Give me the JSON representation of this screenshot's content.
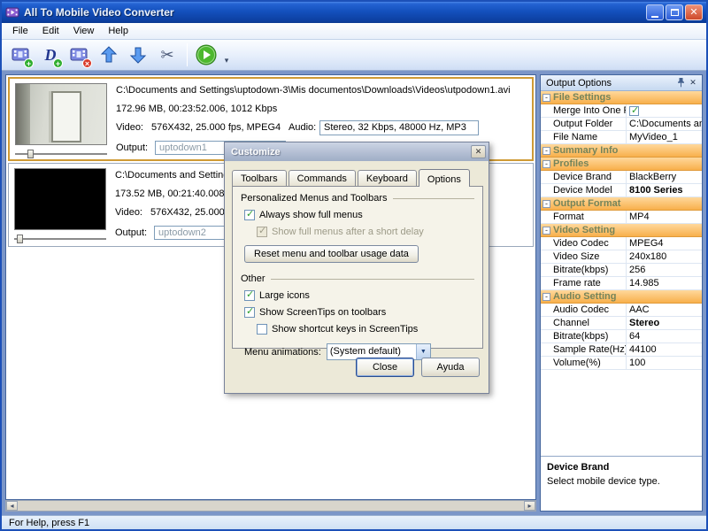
{
  "window": {
    "title": "All To Mobile Video Converter",
    "status": "For Help, press F1"
  },
  "menu": {
    "items": [
      "File",
      "Edit",
      "View",
      "Help"
    ]
  },
  "labels": {
    "video": "Video:",
    "audio": "Audio:",
    "output": "Output:"
  },
  "files": [
    {
      "path": "C:\\Documents and Settings\\uptodown-3\\Mis documentos\\Downloads\\Videos\\utpodown1.avi",
      "info": "172.96 MB, 00:23:52.006, 1012 Kbps",
      "video": "576X432, 25.000 fps, MPEG4",
      "audio": "Stereo, 32 Kbps, 48000 Hz, MP3",
      "output": "uptodown1"
    },
    {
      "path": "C:\\Documents and Settings\\u",
      "info": "173.52 MB, 00:21:40.008, 1",
      "video": "576X432, 25.000 fps,",
      "output": "uptodown2"
    }
  ],
  "dialog": {
    "title": "Customize",
    "tabs": [
      "Toolbars",
      "Commands",
      "Keyboard",
      "Options"
    ],
    "personalized_title": "Personalized Menus and Toolbars",
    "cb_full_menus": "Always show full menus",
    "cb_full_menus_delay": "Show full menus after a short delay",
    "reset_button": "Reset menu and toolbar usage data",
    "other_title": "Other",
    "cb_large_icons": "Large icons",
    "cb_screentips": "Show ScreenTips on toolbars",
    "cb_shortcut_keys": "Show shortcut keys in ScreenTips",
    "menu_animations_label": "Menu animations:",
    "menu_animations_value": "(System default)",
    "close_button": "Close",
    "help_button": "Ayuda"
  },
  "panel": {
    "title": "Output Options",
    "browse_label": "...",
    "sections": [
      {
        "title": "File Settings"
      },
      {
        "title": "Summary Info"
      },
      {
        "title": "Profiles"
      },
      {
        "title": "Output Format"
      },
      {
        "title": "Video Setting"
      },
      {
        "title": "Audio Setting"
      }
    ],
    "rows": {
      "merge_label": "Merge Into One File",
      "output_folder_label": "Output Folder",
      "output_folder_value": "C:\\Documents and",
      "file_name_label": "File Name",
      "file_name_value": "MyVideo_1",
      "device_brand_label": "Device Brand",
      "device_brand_value": "BlackBerry",
      "device_model_label": "Device Model",
      "device_model_value": "8100 Series",
      "format_label": "Format",
      "format_value": "MP4",
      "video_codec_label": "Video Codec",
      "video_codec_value": "MPEG4",
      "video_size_label": "Video Size",
      "video_size_value": "240x180",
      "video_bitrate_label": "Bitrate(kbps)",
      "video_bitrate_value": "256",
      "frame_rate_label": "Frame rate",
      "frame_rate_value": "14.985",
      "audio_codec_label": "Audio Codec",
      "audio_codec_value": "AAC",
      "channel_label": "Channel",
      "channel_value": "Stereo",
      "audio_bitrate_label": "Bitrate(kbps)",
      "audio_bitrate_value": "64",
      "sample_rate_label": "Sample Rate(Hz)",
      "sample_rate_value": "44100",
      "volume_label": "Volume(%)",
      "volume_value": "100"
    },
    "description": {
      "title": "Device Brand",
      "text": "Select mobile device type."
    }
  }
}
